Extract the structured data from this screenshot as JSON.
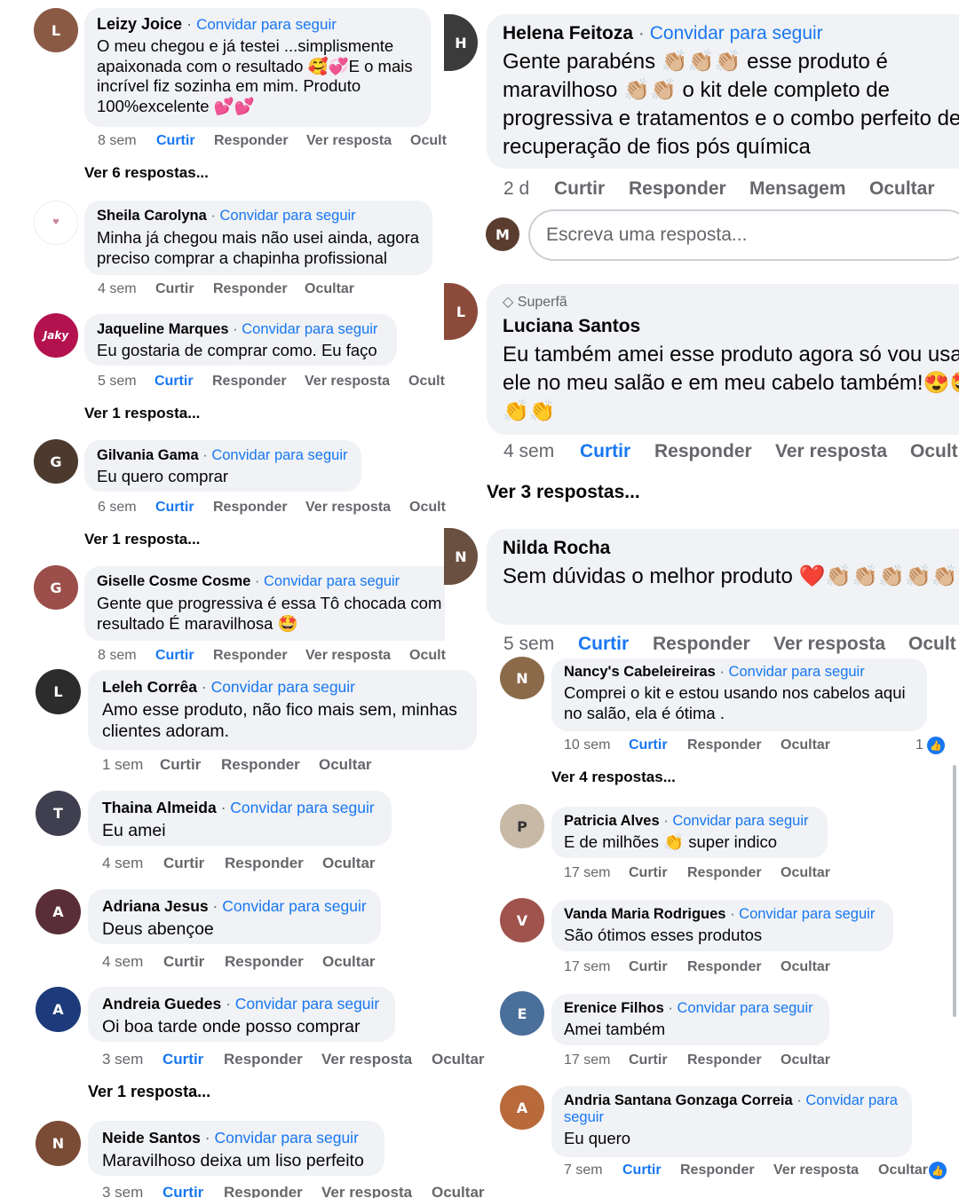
{
  "invite": "Convidar para seguir",
  "sep": "·",
  "actions": {
    "like": "Curtir",
    "reply": "Responder",
    "see_reply": "Ver resposta",
    "hide": "Ocultar",
    "hide_cut": "Ocult",
    "hide_cut2": "Ocultar",
    "message": "Mensagem"
  },
  "left": {
    "c1": {
      "name": "Leizy Joice",
      "text": "O meu chegou e já testei ...simplismente apaixonada com o resultado 🥰💞E o mais incrível fiz sozinha em mim. Produto 100%excelente 💕💕",
      "time": "8 sem",
      "more": "Ver 6 respostas..."
    },
    "c2": {
      "name": "Sheila Carolyna",
      "text": "Minha já chegou mais não usei ainda, agora preciso comprar a chapinha profissional",
      "time": "4 sem"
    },
    "c3": {
      "name": "Jaqueline Marques",
      "text": "Eu gostaria de comprar como.  Eu faço",
      "time": "5 sem",
      "more": "Ver 1 resposta..."
    },
    "c4": {
      "name": "Gilvania Gama",
      "text": "Eu quero comprar",
      "time": "6 sem",
      "more": "Ver 1 resposta..."
    },
    "c5": {
      "name": "Giselle Cosme Cosme",
      "text": "Gente que progressiva é essa Tô chocada com resultado É maravilhosa 🤩",
      "time": "8 sem"
    },
    "c6": {
      "name": "Leleh Corrêa",
      "text": "Amo esse produto, não fico mais sem, minhas clientes adoram.",
      "time": "1 sem"
    },
    "c7": {
      "name": "Thaina Almeida",
      "text": "Eu amei",
      "time": "4 sem"
    },
    "c8": {
      "name": "Adriana Jesus",
      "text": "Deus abençoe",
      "time": "4 sem"
    },
    "c9": {
      "name": "Andreia Guedes",
      "text": "Oi boa tarde onde posso comprar",
      "time": "3 sem",
      "more": "Ver 1 resposta..."
    },
    "c10": {
      "name": "Neide Santos",
      "text": "Maravilhoso deixa um liso perfeito",
      "time": "3 sem"
    }
  },
  "right": {
    "r1": {
      "name": "Helena Feitoza",
      "text": "Gente parabéns 👏🏼👏🏼👏🏼 esse produto é maravilhoso 👏🏼👏🏼 o kit dele completo de progressiva e tratamentos e o combo perfeito de recuperação de fios pós química",
      "time": "2 d"
    },
    "reply_placeholder": "Escreva uma resposta...",
    "r2": {
      "badge": "Superfã",
      "name": "Luciana Santos",
      "text": "Eu também amei esse produto agora só vou usar ele no meu salão e em meu cabelo também!😍🤩👏👏",
      "time": "4 sem",
      "more": "Ver 3 respostas..."
    },
    "r3": {
      "name": "Nilda Rocha",
      "text": "Sem dúvidas o melhor produto ❤️👏🏼👏🏼👏🏼👏🏼👏🏼",
      "time": "5 sem"
    },
    "r4": {
      "name": "Nancy's Cabeleireiras",
      "text": "Comprei o kit e estou usando nos cabelos aqui no salão, ela é ótima .",
      "time": "10 sem",
      "likes": "1",
      "more": "Ver 4 respostas..."
    },
    "r5": {
      "name": "Patricia Alves",
      "text": "E de milhões 👏 super indico",
      "time": "17 sem"
    },
    "r6": {
      "name": "Vanda Maria Rodrigues",
      "text": "São ótimos esses produtos",
      "time": "17 sem"
    },
    "r7": {
      "name": "Erenice Filhos",
      "text": "Amei também",
      "time": "17 sem"
    },
    "r8": {
      "name": "Andria Santana Gonzaga Correia",
      "text": "Eu quero",
      "time": "7 sem"
    }
  },
  "colors": {
    "link": "#1877f2",
    "bubble": "#f0f2f5",
    "muted": "#65676b"
  }
}
